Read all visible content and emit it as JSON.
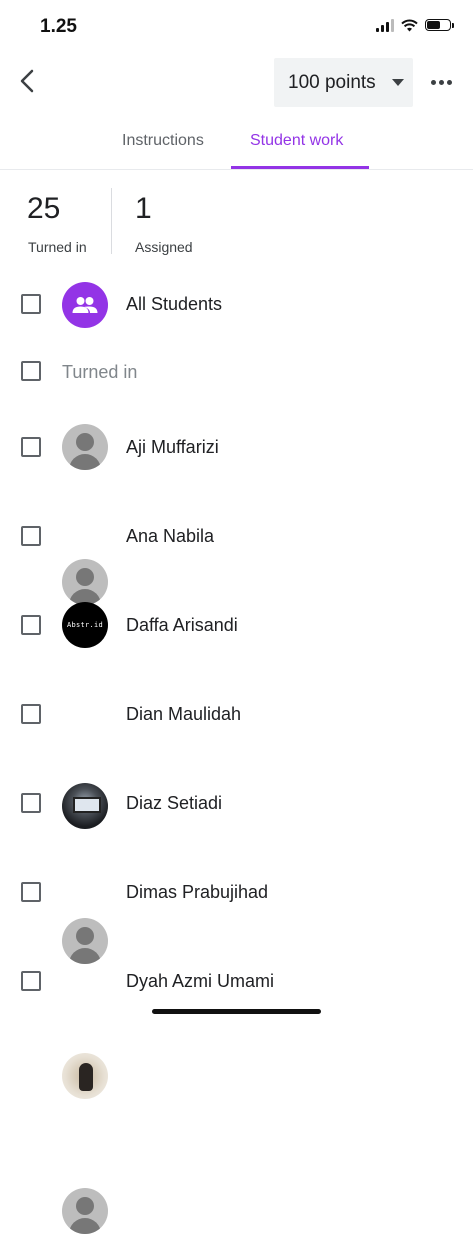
{
  "status_bar": {
    "time": "1.25"
  },
  "header": {
    "points_label": "100 points"
  },
  "tabs": [
    {
      "label": "Instructions"
    },
    {
      "label": "Student work"
    }
  ],
  "stats": {
    "turned_in": {
      "count": "25",
      "label": "Turned in"
    },
    "assigned": {
      "count": "1",
      "label": "Assigned"
    }
  },
  "all_students_label": "All Students",
  "section_label": "Turned in",
  "students": [
    {
      "name": "Aji Muffarizi",
      "avatar": "default"
    },
    {
      "name": "Ana Nabila",
      "avatar": "default"
    },
    {
      "name": "Daffa Arisandi",
      "avatar": "abstr-logo",
      "avatar_text": "Abstr.id"
    },
    {
      "name": "Dian Maulidah",
      "avatar": "photo"
    },
    {
      "name": "Diaz Setiadi",
      "avatar": "default"
    },
    {
      "name": "Dimas Prabujihad",
      "avatar": "photo"
    },
    {
      "name": "Dyah Azmi Umami",
      "avatar": "default"
    }
  ],
  "colors": {
    "accent": "#9334e6",
    "chip_bg": "#f1f3f4",
    "divider": "#e8eaed"
  },
  "icons": [
    "back-arrow-icon",
    "dropdown-caret-icon",
    "more-horiz-icon",
    "group-icon",
    "person-icon"
  ]
}
